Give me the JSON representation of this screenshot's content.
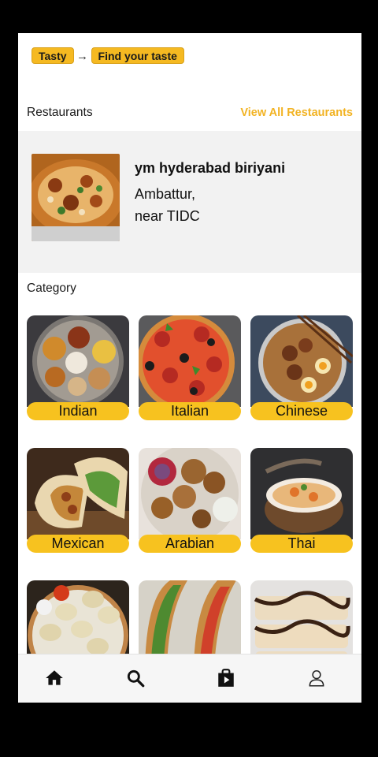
{
  "header": {
    "app_chip": "Tasty",
    "arrow": "→",
    "tagline_chip": "Find your taste"
  },
  "restaurants": {
    "title": "Restaurants",
    "view_all": "View All Restaurants",
    "featured": {
      "name": "ym hyderabad biriyani",
      "address_line1": "Ambattur,",
      "address_line2": "near TIDC"
    }
  },
  "category": {
    "title": "Category",
    "items": [
      {
        "label": "Indian"
      },
      {
        "label": "Italian"
      },
      {
        "label": "Chinese"
      },
      {
        "label": "Mexican"
      },
      {
        "label": "Arabian"
      },
      {
        "label": "Thai"
      },
      {
        "label": ""
      },
      {
        "label": ""
      },
      {
        "label": ""
      }
    ]
  },
  "nav": {
    "icons": [
      "home-icon",
      "search-icon",
      "shop-icon",
      "profile-icon"
    ],
    "active": "home-icon"
  },
  "colors": {
    "accent": "#f5b921",
    "label_bg": "#f7c21f",
    "card_bg": "#f2f2f2"
  }
}
